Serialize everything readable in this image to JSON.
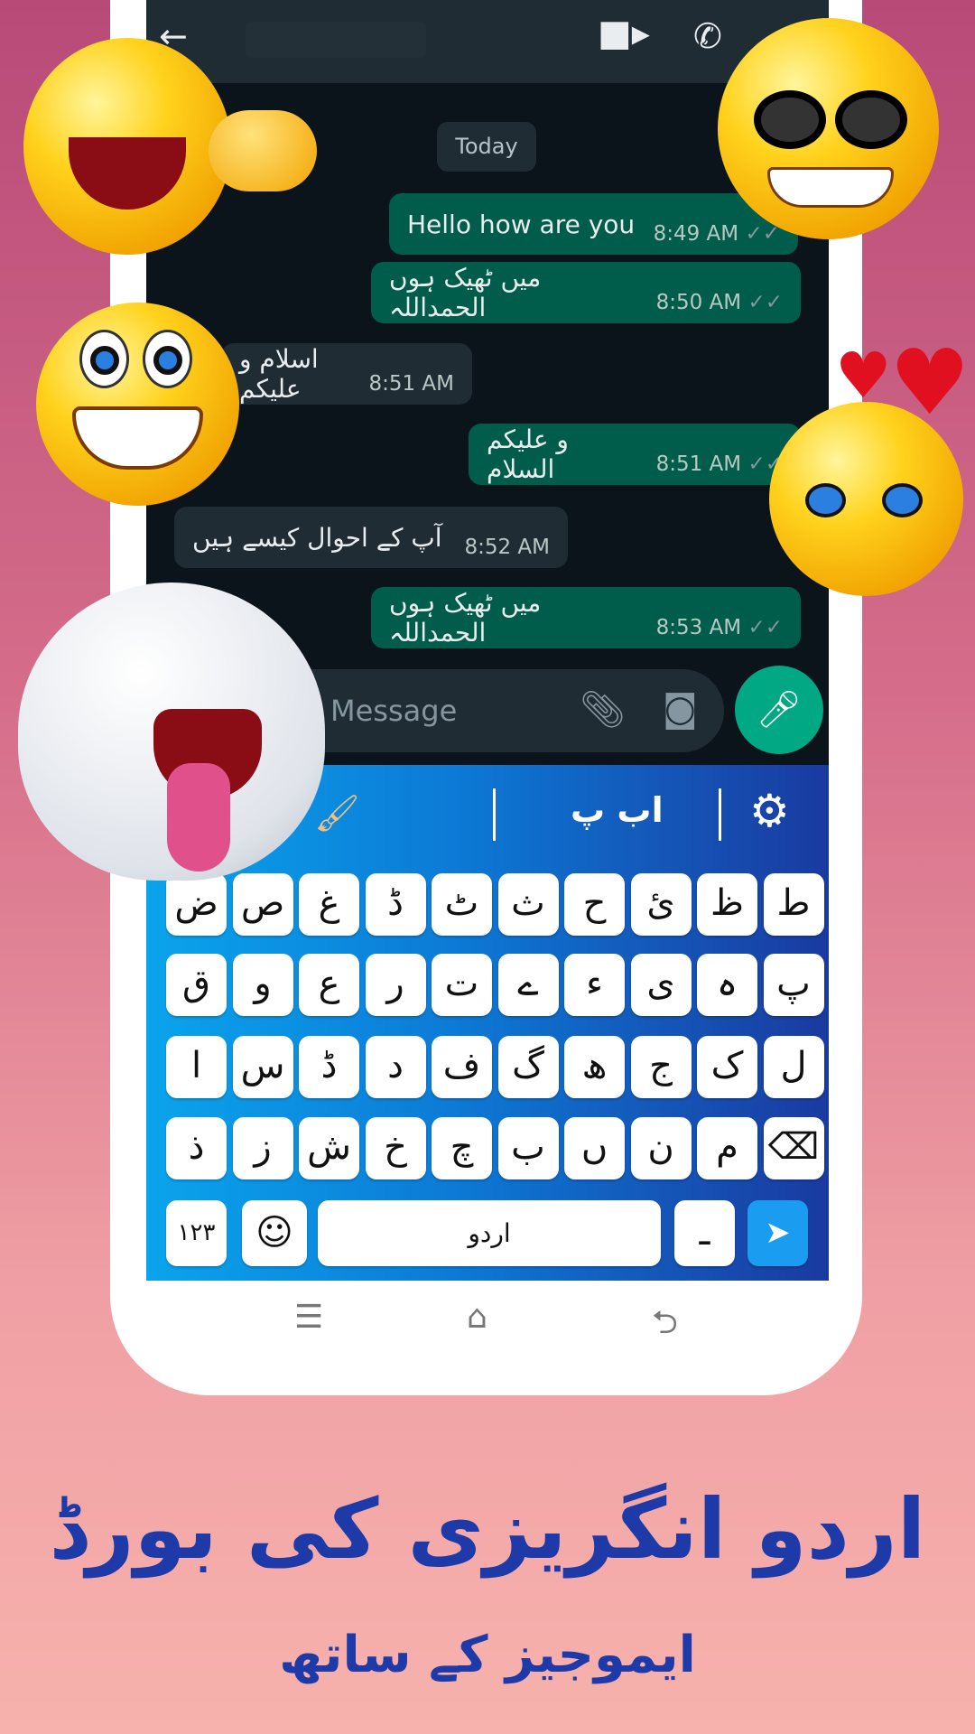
{
  "chat": {
    "date_label": "Today",
    "messages": [
      {
        "dir": "out",
        "text": "Hello how are you",
        "time": "8:49 AM",
        "ticks": "✓✓"
      },
      {
        "dir": "out",
        "text": "میں ٹھیک ہوں الحمداللہ",
        "time": "8:50 AM",
        "ticks": "✓✓"
      },
      {
        "dir": "in",
        "text": "اسلام و علیکم",
        "time": "8:51 AM"
      },
      {
        "dir": "out",
        "text": "و علیکم السلام",
        "time": "8:51 AM",
        "ticks": "✓✓"
      },
      {
        "dir": "in",
        "text": "آپ کے احوال کیسے ہیں",
        "time": "8:52 AM"
      },
      {
        "dir": "out",
        "text": "میں ٹھیک ہوں الحمداللہ",
        "time": "8:53 AM",
        "ticks": "✓✓"
      }
    ],
    "input_placeholder": "Message",
    "icons": {
      "back": "arrow-left-icon",
      "video": "video-camera-icon",
      "call": "phone-icon",
      "menu": "more-vertical-icon",
      "attach": "paperclip-icon",
      "camera": "camera-icon",
      "mic": "microphone-icon"
    }
  },
  "keyboard": {
    "toolbar": {
      "theme_icon": "paint-brush-icon",
      "layout_label": "اب پ",
      "settings_icon": "gear-icon"
    },
    "rows": [
      [
        "ض",
        "ص",
        "غ",
        "ڈ",
        "ٹ",
        "ث",
        "ح",
        "ئ",
        "ظ",
        "ط"
      ],
      [
        "ق",
        "و",
        "ع",
        "ر",
        "ت",
        "ے",
        "ء",
        "ی",
        "ہ",
        "پ"
      ],
      [
        "ا",
        "س",
        "ڈ",
        "د",
        "ف",
        "گ",
        "ھ",
        "ج",
        "ک",
        "ل"
      ],
      [
        "ذ",
        "ز",
        "ش",
        "خ",
        "چ",
        "ب",
        "ں",
        "ن",
        "م",
        "⌫"
      ]
    ],
    "numbers_label": "١٢٣",
    "space_label": "اردو",
    "dash_label": "ـ",
    "colors": {
      "gradient_left": "#0aa4ec",
      "gradient_right": "#1a3aa0",
      "send": "#1a9cf0"
    }
  },
  "promo": {
    "title": "اردو انگریزی کی بورڈ",
    "subtitle": "ایموجیز کے ساتھ",
    "color": "#1d3aa8"
  }
}
